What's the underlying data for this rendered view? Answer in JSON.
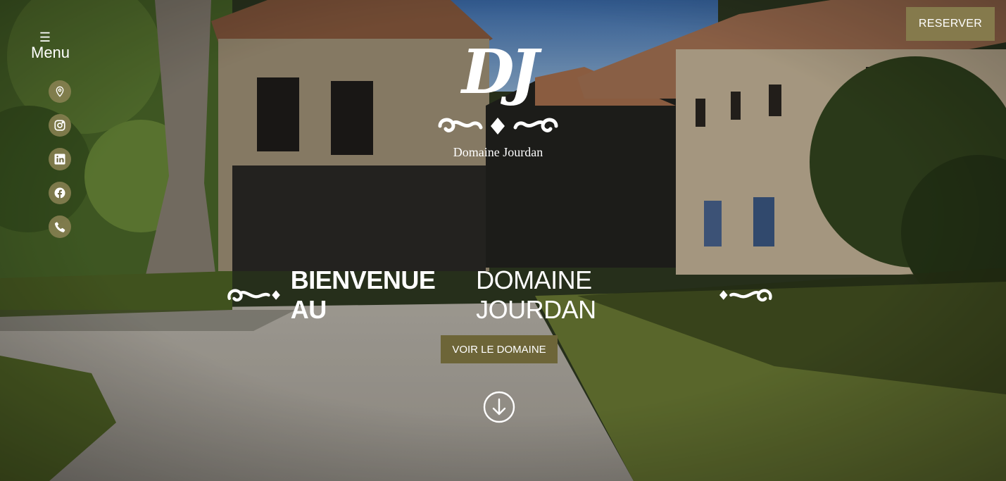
{
  "nav": {
    "menu_label": "Menu",
    "menu_icon": "☰",
    "reserve_label": "RESERVER"
  },
  "socials": [
    {
      "name": "location-icon"
    },
    {
      "name": "instagram-icon"
    },
    {
      "name": "linkedin-icon"
    },
    {
      "name": "facebook-icon"
    },
    {
      "name": "phone-icon"
    }
  ],
  "logo": {
    "monogram": "DJ",
    "wordmark": "Domaine Jourdan"
  },
  "hero": {
    "title_bold": "BIENVENUE AU",
    "title_light": "DOMAINE JOURDAN",
    "cta_label": "VOIR LE DOMAINE"
  },
  "colors": {
    "accent": "#857a4c",
    "cta": "#6d6538",
    "text": "#ffffff"
  }
}
